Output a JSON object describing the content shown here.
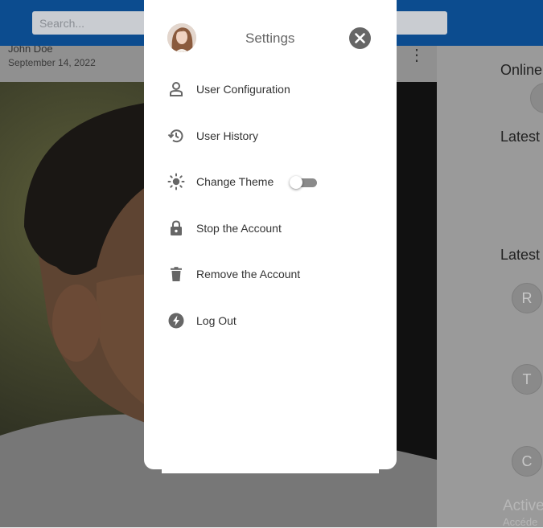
{
  "search": {
    "placeholder": "Search..."
  },
  "post": {
    "author": "John Doe",
    "date": "September 14, 2022",
    "more_icon": "more-vert-icon"
  },
  "sidebar": {
    "online_title": "Online",
    "latest_title_1": "Latest",
    "latest_title_2": "Latest",
    "avatars": [
      "R",
      "T",
      "C"
    ],
    "active_title": "Active",
    "active_sub": "Accéde"
  },
  "settings": {
    "title": "Settings",
    "close_icon": "close-icon",
    "items": [
      {
        "label": "User Configuration",
        "icon": "user-icon"
      },
      {
        "label": "User History",
        "icon": "history-icon"
      },
      {
        "label": "Change Theme",
        "icon": "brightness-icon"
      },
      {
        "label": "Stop the Account",
        "icon": "lock-icon"
      },
      {
        "label": "Remove the Account",
        "icon": "trash-icon"
      },
      {
        "label": "Log Out",
        "icon": "bolt-icon"
      }
    ],
    "theme_toggle": {
      "on": false
    }
  },
  "colors": {
    "header": "#0c4c8f",
    "overlay_icon": "#666666",
    "toggle_track": "#8a8a8a"
  }
}
